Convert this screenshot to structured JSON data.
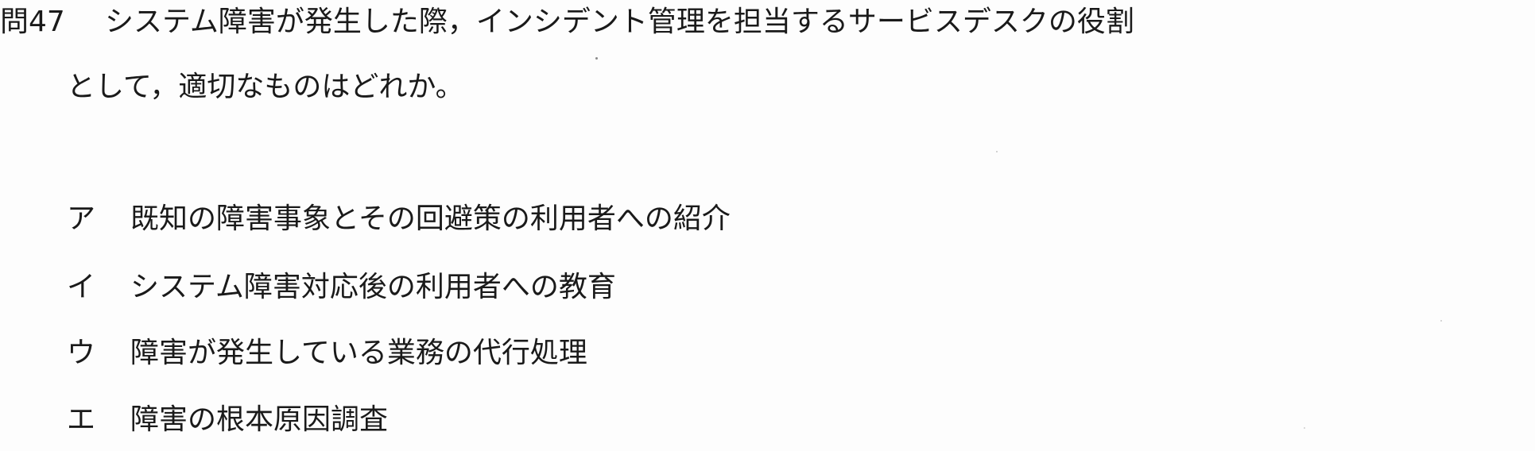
{
  "question": {
    "number": "問47",
    "text_line1": "システム障害が発生した際，インシデント管理を担当するサービスデスクの役割",
    "text_line2": "として，適切なものはどれか。"
  },
  "choices": [
    {
      "mark": "ア",
      "text": "既知の障害事象とその回避策の利用者への紹介"
    },
    {
      "mark": "イ",
      "text": "システム障害対応後の利用者への教育"
    },
    {
      "mark": "ウ",
      "text": "障害が発生している業務の代行処理"
    },
    {
      "mark": "エ",
      "text": "障害の根本原因調査"
    }
  ]
}
